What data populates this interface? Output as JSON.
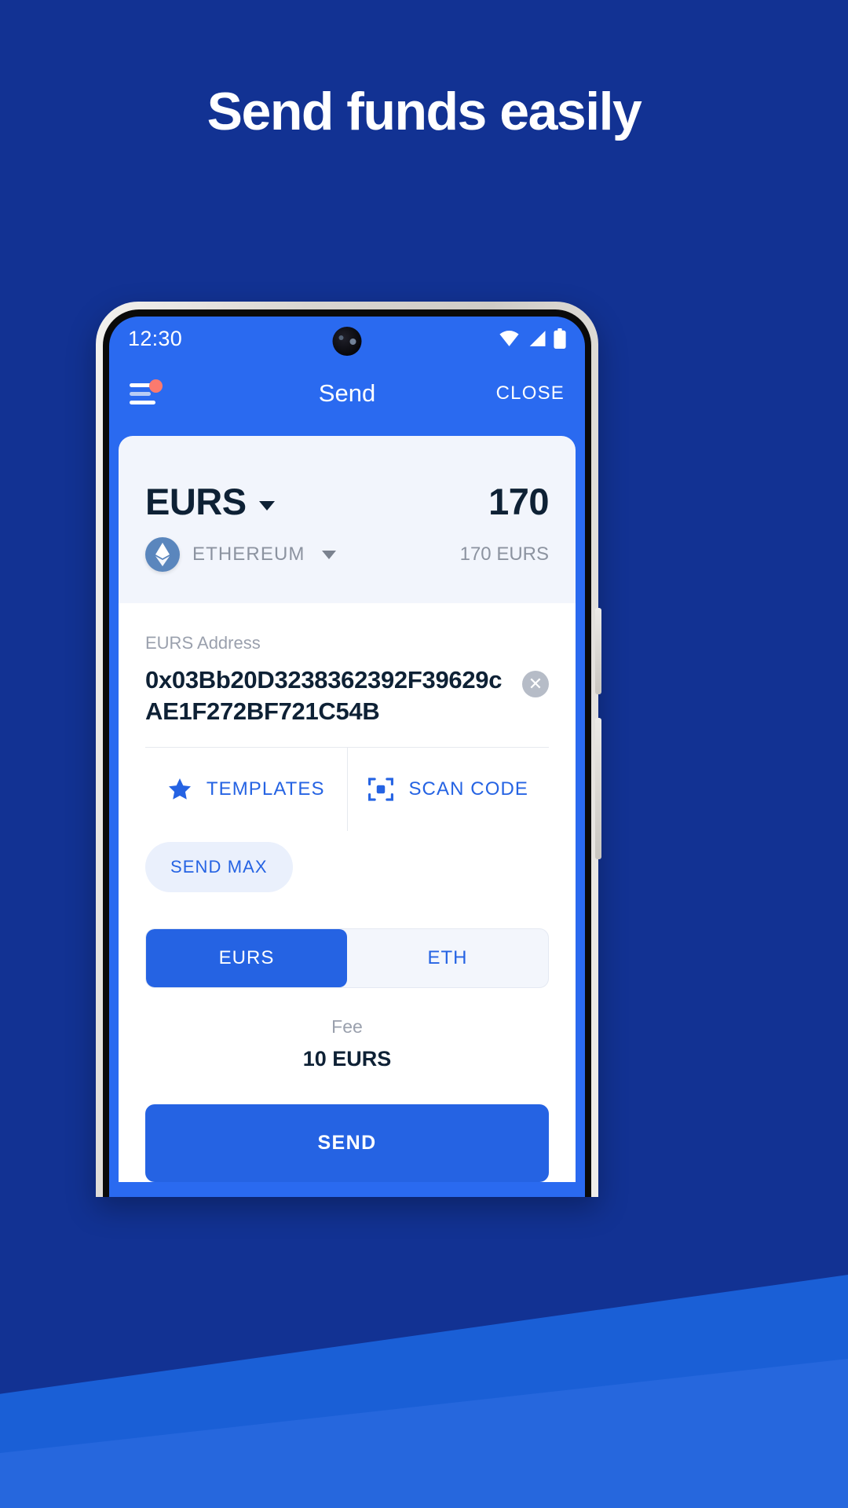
{
  "headline": "Send funds easily",
  "theme": {
    "background": "#123293",
    "accent": "#2563e3",
    "screen_blue": "#2a6af0",
    "card_bg": "#f2f5fc",
    "text_dark": "#0e2135",
    "text_muted": "#9aa0ad",
    "badge_red": "#fb7a6e"
  },
  "phone": {
    "statusbar": {
      "clock": "12:30",
      "icons": [
        "wifi-icon",
        "cellular-signal-icon",
        "battery-icon"
      ]
    },
    "appbar": {
      "menu_icon": "hamburger-menu-icon",
      "has_notification_dot": true,
      "title": "Send",
      "close_label": "CLOSE"
    },
    "balance_card": {
      "ticker": "EURS",
      "ticker_caret": "chevron-down-icon",
      "amount": "170",
      "network_icon": "ethereum-icon",
      "network": "ETHEREUM",
      "network_caret": "chevron-down-icon",
      "sub_amount": "170 EURS"
    },
    "form": {
      "address_label": "EURS Address",
      "address_value": "0x03Bb20D3238362392F39629cAE1F272BF721C54B",
      "clear_icon": "close-circle-icon",
      "actions": [
        {
          "icon": "star-icon",
          "label": "TEMPLATES"
        },
        {
          "icon": "qr-scan-icon",
          "label": "SCAN CODE"
        }
      ],
      "send_max_label": "SEND MAX",
      "fee_currency_options": [
        "EURS",
        "ETH"
      ],
      "fee_currency_selected": "EURS",
      "fee_label": "Fee",
      "fee_value": "10 EURS",
      "submit_label": "SEND"
    }
  }
}
